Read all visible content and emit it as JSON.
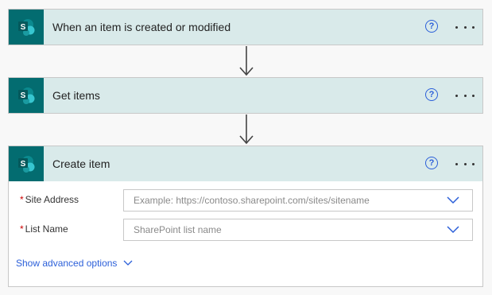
{
  "cards": [
    {
      "title": "When an item is created or modified",
      "logo_letter": "S"
    },
    {
      "title": "Get items",
      "logo_letter": "S"
    },
    {
      "title": "Create item",
      "logo_letter": "S"
    }
  ],
  "help_icon_text": "?",
  "create_item": {
    "fields": [
      {
        "label": "Site Address",
        "required_mark": "*",
        "placeholder": "Example: https://contoso.sharepoint.com/sites/sitename"
      },
      {
        "label": "List Name",
        "required_mark": "*",
        "placeholder": "SharePoint list name"
      }
    ],
    "advanced_link": "Show advanced options"
  },
  "colors": {
    "logo_bg": "#036c70",
    "header_bg": "#d9eaea",
    "link": "#2b5fd9",
    "required": "#cc0000"
  },
  "icons": [
    "sharepoint-logo-icon",
    "help-icon",
    "more-options-icon",
    "down-arrow-icon",
    "chevron-down-icon"
  ]
}
